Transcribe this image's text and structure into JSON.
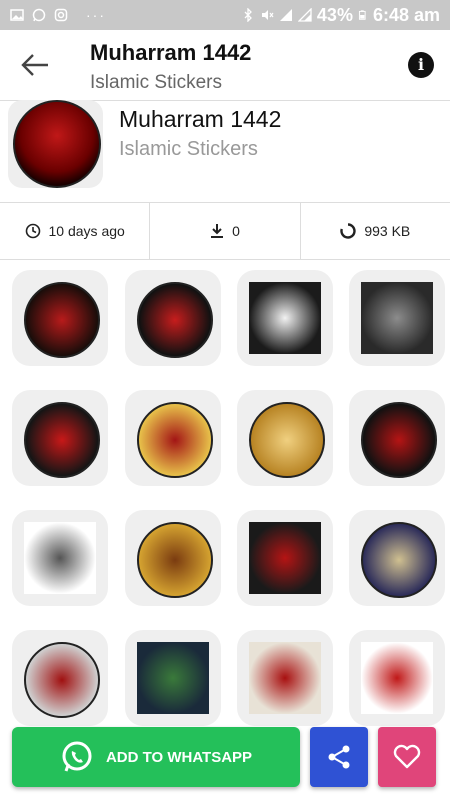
{
  "status_bar": {
    "battery": "43%",
    "time": "6:48 am",
    "icons": [
      "image-icon",
      "whatsapp-icon",
      "instagram-icon",
      "more-dots-icon",
      "bluetooth-icon",
      "mute-icon",
      "signal-icon",
      "wifi-icon",
      "battery-icon"
    ]
  },
  "app_bar": {
    "title": "Muharram 1442",
    "subtitle": "Islamic Stickers"
  },
  "pack": {
    "title": "Muharram 1442",
    "subtitle": "Islamic Stickers"
  },
  "stats": {
    "updated": "10 days ago",
    "downloads": "0",
    "size": "993 KB"
  },
  "stickers": [
    {
      "colors": [
        "#1a0d0a",
        "#b81b1b"
      ],
      "shape": "round"
    },
    {
      "colors": [
        "#111111",
        "#c71d1d"
      ],
      "shape": "round"
    },
    {
      "colors": [
        "#1b1b1b",
        "#f2f2f2"
      ],
      "shape": "square"
    },
    {
      "colors": [
        "#2a2a2a",
        "#8c8c8c"
      ],
      "shape": "square"
    },
    {
      "colors": [
        "#151515",
        "#c81818"
      ],
      "shape": "round"
    },
    {
      "colors": [
        "#e7c04a",
        "#a31515"
      ],
      "shape": "round"
    },
    {
      "colors": [
        "#b88424",
        "#f0d080"
      ],
      "shape": "round"
    },
    {
      "colors": [
        "#111111",
        "#b51414"
      ],
      "shape": "round"
    },
    {
      "colors": [
        "#ffffff",
        "#555555"
      ],
      "shape": "square"
    },
    {
      "colors": [
        "#d4a230",
        "#7a3b10"
      ],
      "shape": "round"
    },
    {
      "colors": [
        "#1a1a1a",
        "#b51414"
      ],
      "shape": "square"
    },
    {
      "colors": [
        "#2d2d5a",
        "#d0c090"
      ],
      "shape": "round"
    },
    {
      "colors": [
        "#cfcfcf",
        "#a01010"
      ],
      "shape": "round"
    },
    {
      "colors": [
        "#1a2a3a",
        "#3a7a3a"
      ],
      "shape": "square"
    },
    {
      "colors": [
        "#e8e2d6",
        "#a81010"
      ],
      "shape": "square"
    },
    {
      "colors": [
        "#ffffff",
        "#c01818"
      ],
      "shape": "square"
    }
  ],
  "actions": {
    "add_to_whatsapp": "ADD TO WHATSAPP"
  },
  "colors": {
    "whatsapp_green": "#24c05a",
    "share_blue": "#2f52d4",
    "like_pink": "#e0457a"
  }
}
